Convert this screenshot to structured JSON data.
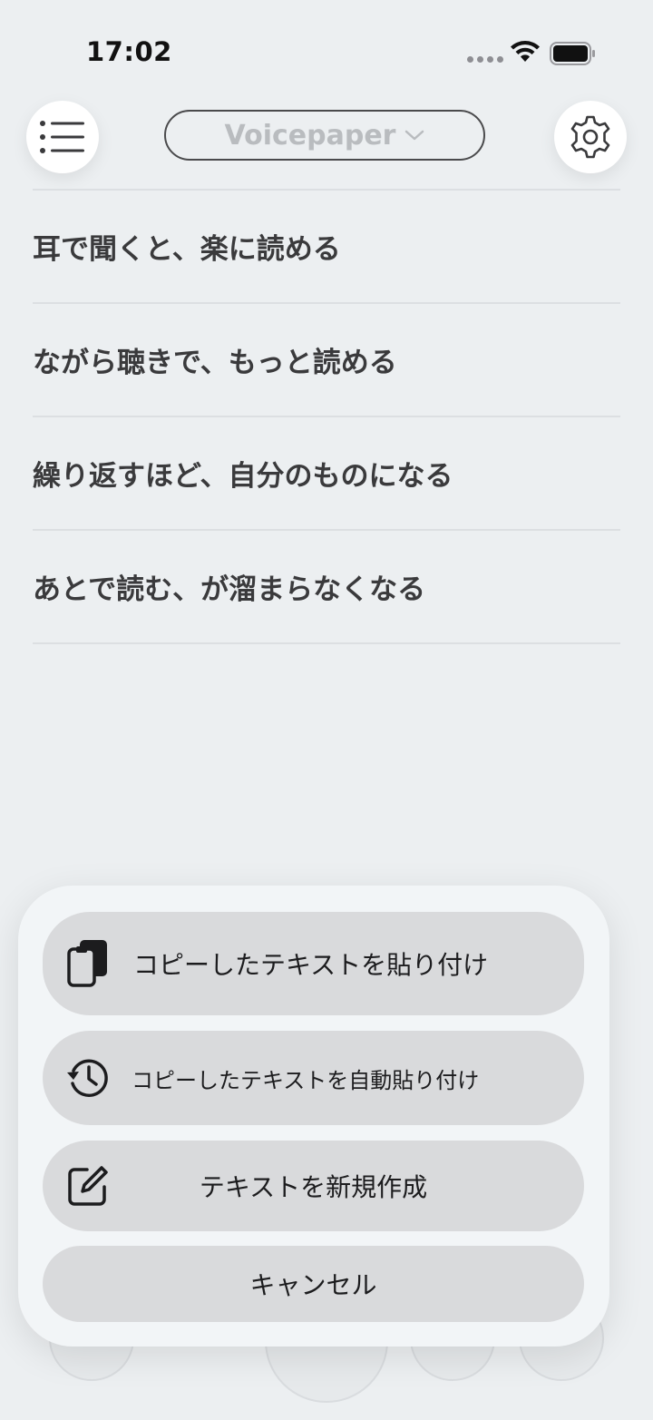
{
  "status_bar": {
    "time": "17:02"
  },
  "header": {
    "title": "Voicepaper",
    "menu_icon": "list-icon",
    "settings_icon": "gear-icon"
  },
  "list": {
    "items": [
      {
        "label": "耳で聞くと、楽に読める"
      },
      {
        "label": "ながら聴きで、もっと読める"
      },
      {
        "label": "繰り返すほど、自分のものになる"
      },
      {
        "label": "あとで読む、が溜まらなくなる"
      }
    ]
  },
  "sheet": {
    "paste_label": "コピーしたテキストを貼り付け",
    "auto_paste_label": "コピーしたテキストを自動貼り付け",
    "new_text_label": "テキストを新規作成",
    "cancel_label": "キャンセル"
  },
  "colors": {
    "background": "#eceff1",
    "sheet_background": "#f2f5f7",
    "button_background": "#d9dadc",
    "title_text": "#b9bcbf",
    "list_text": "#3a3a3c"
  }
}
